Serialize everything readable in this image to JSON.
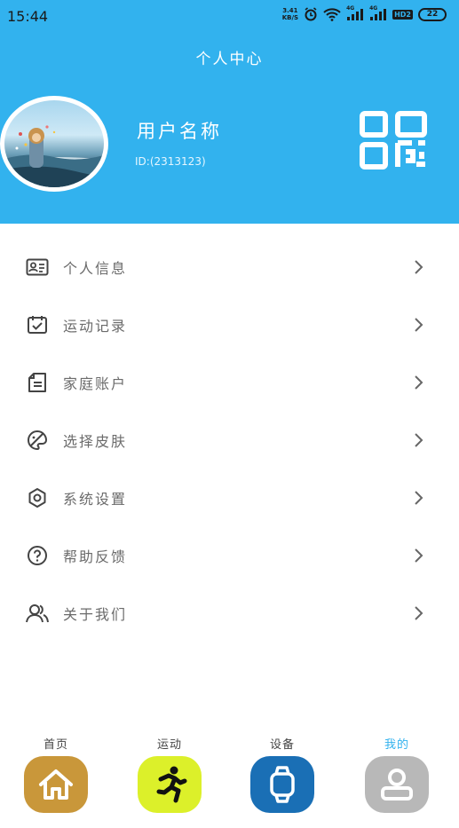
{
  "status_bar": {
    "time": "15:44",
    "net_speed": "3.41",
    "net_unit": "KB/S",
    "network_badge": "HD2",
    "signal_label_1": "4G",
    "signal_label_2": "4G",
    "battery": "22"
  },
  "header": {
    "title": "个人中心",
    "username": "用户名称",
    "user_id": "ID:(2313123)",
    "background_color": "#32b2ee"
  },
  "menu": {
    "items": [
      {
        "label": "个人信息",
        "icon": "id-card-icon"
      },
      {
        "label": "运动记录",
        "icon": "calendar-check-icon"
      },
      {
        "label": "家庭账户",
        "icon": "document-icon"
      },
      {
        "label": "选择皮肤",
        "icon": "palette-icon"
      },
      {
        "label": "系统设置",
        "icon": "gear-icon"
      },
      {
        "label": "帮助反馈",
        "icon": "help-circle-icon"
      },
      {
        "label": "关于我们",
        "icon": "people-icon"
      }
    ]
  },
  "tab_bar": {
    "tabs": [
      {
        "label": "首页",
        "icon": "home-icon",
        "color": "#c9973a"
      },
      {
        "label": "运动",
        "icon": "running-man-icon",
        "color": "#dcf02a"
      },
      {
        "label": "设备",
        "icon": "smartwatch-icon",
        "color": "#1a6fb5"
      },
      {
        "label": "我的",
        "icon": "user-icon",
        "color": "#b8b8b8",
        "active": true
      }
    ],
    "active_color": "#32b2ee"
  }
}
